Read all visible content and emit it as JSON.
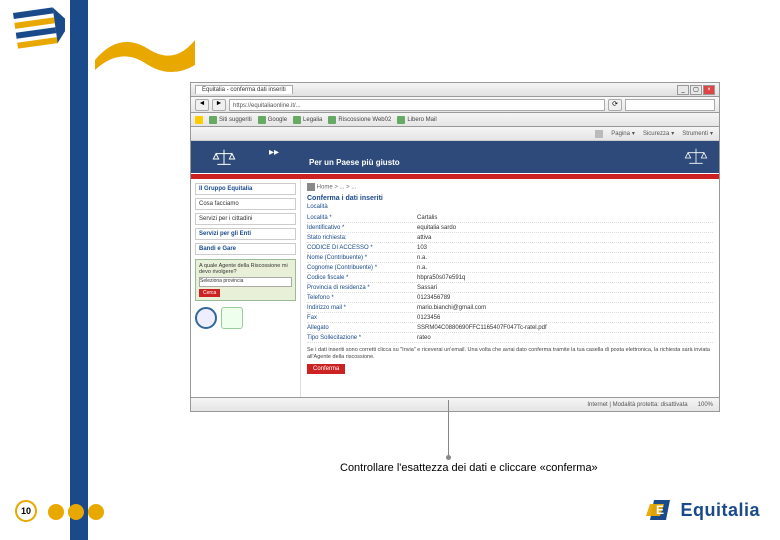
{
  "browser": {
    "tab_title": "Equitalia - conferma dati inseriti",
    "url": "https://equitaliaonline.it/...",
    "bookmarks": [
      "Siti suggeriti",
      "Google",
      "Legalia",
      "Riscossione Web02",
      "Libero Mail"
    ],
    "toolbar": [
      "Pagina",
      "Sicurezza",
      "Strumenti"
    ]
  },
  "site": {
    "slogan": "Per un Paese più giusto"
  },
  "sidebar": {
    "items": [
      "Il Gruppo Equitalia",
      "Cosa facciamo",
      "Servizi per i cittadini",
      "Servizi per gli Enti",
      "Bandi e Gare"
    ],
    "agent_box": "A quale Agente della Riscossione mi devo rivolgere?",
    "select_placeholder": "Seleziona provincia",
    "search_btn": "Cerca"
  },
  "breadcrumb": "Home  >  ...  >  ...",
  "panel": {
    "title": "Conferma i dati inseriti",
    "subtitle": "Località"
  },
  "form": {
    "rows": [
      {
        "label": "Località *",
        "value": "Cartalis"
      },
      {
        "label": "Identificativo *",
        "value": "equitalia sardo"
      },
      {
        "label": "Stato richiesta:",
        "value": "attiva"
      },
      {
        "label": "CODICE DI ACCESSO *",
        "value": "103"
      },
      {
        "label": "Nome (Contribuente) *",
        "value": "n.a."
      },
      {
        "label": "Cognome (Contribuente) *",
        "value": "n.a."
      },
      {
        "label": "Codice fiscale *",
        "value": "hbpra50s07e591q"
      },
      {
        "label": "Provincia di residenza *",
        "value": "Sassari"
      },
      {
        "label": "Telefono *",
        "value": "0123456789"
      },
      {
        "label": "Indirizzo mail *",
        "value": "mario.bianchi@gmail.com"
      },
      {
        "label": "Fax",
        "value": "0123456"
      },
      {
        "label": "Allegato",
        "value": "SSRM04C0880690FFC1165407F047Tc-ratel.pdf"
      },
      {
        "label": "Tipo Sollecitazione *",
        "value": "rateo"
      }
    ],
    "note": "Se i dati inseriti sono corretti clicca su \"Invia\" e riceverai un'email. Una volta che avrai dato conferma tramite la tua casella di posta elettronica, la richiesta sarà inviata all'Agente della riscossione.",
    "confirm_btn": "Conferma"
  },
  "status": {
    "text": "Internet | Modalità protetta: disattivata",
    "zoom": "100%"
  },
  "callout": "Controllare l'esattezza dei dati e cliccare «conferma»",
  "footer": {
    "page": "10",
    "brand": "Equitalia"
  }
}
